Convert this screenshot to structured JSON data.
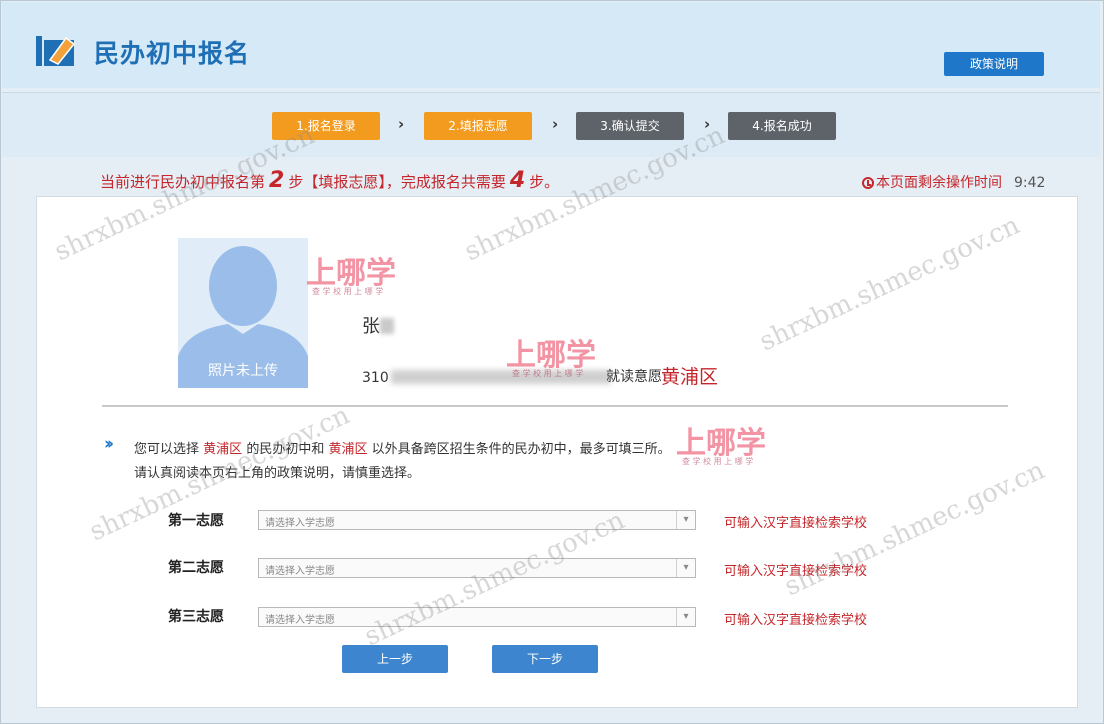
{
  "header": {
    "title": "民办初中报名",
    "policy_button": "政策说明"
  },
  "steps": [
    {
      "label": "1.报名登录",
      "state": "done"
    },
    {
      "label": "2.填报志愿",
      "state": "current"
    },
    {
      "label": "3.确认提交",
      "state": "todo"
    },
    {
      "label": "4.报名成功",
      "state": "todo"
    }
  ],
  "status": {
    "prefix": "当前进行民办初中报名第",
    "current_step": "2",
    "middle": "步【填报志愿】，完成报名共需要",
    "total_steps": "4",
    "suffix": "步。",
    "timer_label": "本页面剩余操作时间",
    "timer_value": "9:42"
  },
  "student": {
    "photo_label": "照片未上传",
    "name_visible": "张",
    "id_visible": "310",
    "district_label": "就读意愿:",
    "district_value": "黄浦区"
  },
  "info": {
    "line1_a": "您可以选择",
    "district1": "黄浦区",
    "line1_b": "的民办初中和",
    "district2": "黄浦区",
    "line1_c": "以外具备跨区招生条件的民办初中，最多可填三所。",
    "line2": "请认真阅读本页右上角的政策说明，请慎重选择。"
  },
  "choices": [
    {
      "label": "第一志愿",
      "placeholder": "请选择入学志愿",
      "hint": "可输入汉字直接检索学校"
    },
    {
      "label": "第二志愿",
      "placeholder": "请选择入学志愿",
      "hint": "可输入汉字直接检索学校"
    },
    {
      "label": "第三志愿",
      "placeholder": "请选择入学志愿",
      "hint": "可输入汉字直接检索学校"
    }
  ],
  "buttons": {
    "prev": "上一步",
    "next": "下一步"
  },
  "watermarks": {
    "site": "shrxbm.shmec.gov.cn",
    "brand": "上哪学",
    "brand_sub": "查 学 校  用 上 哪 学"
  },
  "colors": {
    "accent_blue": "#1e77c8",
    "step_active": "#f39b1f",
    "step_inactive": "#5e6369",
    "alert_red": "#c4262b"
  }
}
